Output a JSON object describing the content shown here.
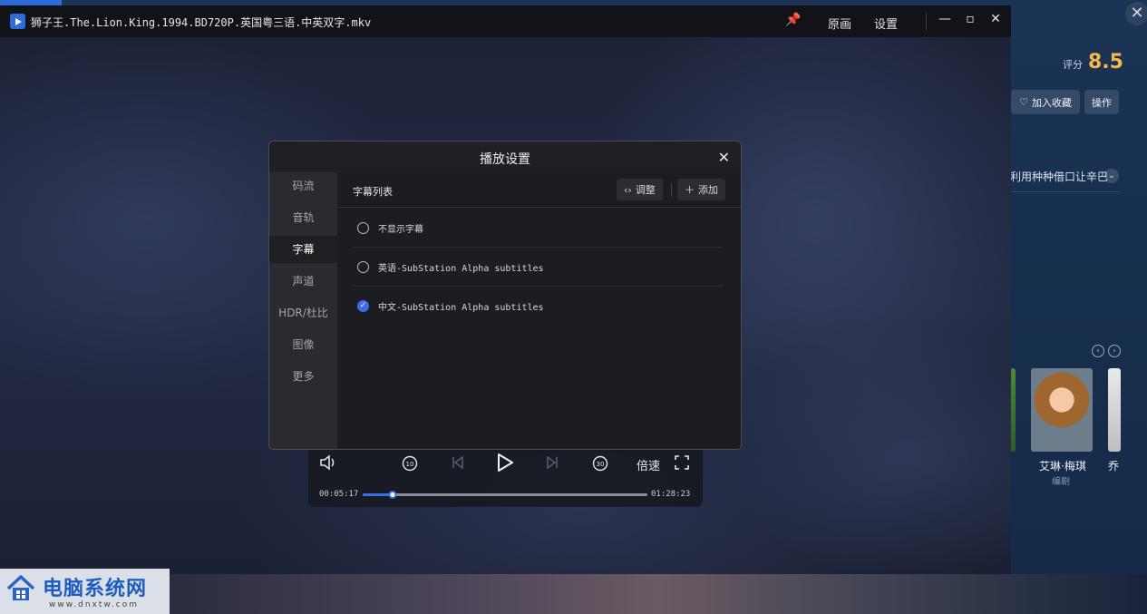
{
  "window": {
    "title": "狮子王.The.Lion.King.1994.BD720P.英国粤三语.中英双字.mkv",
    "menu": {
      "original_label": "原画",
      "settings_label": "设置"
    }
  },
  "controls": {
    "speed_label": "倍速",
    "current_time": "00:05:17",
    "total_time": "01:28:23",
    "progress": 0.106,
    "rewind_label": "10",
    "forward_label": "30"
  },
  "dialog": {
    "title": "播放设置",
    "tabs": [
      "码流",
      "音轨",
      "字幕",
      "声道",
      "HDR/杜比",
      "图像",
      "更多"
    ],
    "active_tab": "字幕",
    "list_title": "字幕列表",
    "adjust_label": "调整",
    "add_label": "添加",
    "subtitles": [
      {
        "label": "不显示字幕",
        "selected": false
      },
      {
        "label": "英语-SubStation Alpha subtitles",
        "selected": false
      },
      {
        "label": "中文-SubStation Alpha subtitles",
        "selected": true
      }
    ]
  },
  "background_app": {
    "rating_label": "评分",
    "rating_value": "8.5",
    "favorite_label": "加入收藏",
    "operate_label": "操作",
    "description_snippet": "利用种种借口让辛巴",
    "cast": [
      {
        "name": "艾琳·梅琪",
        "role": "编剧"
      },
      {
        "name": "乔",
        "role": ""
      }
    ]
  },
  "watermark": {
    "title": "电脑系统网",
    "url": "www.dnxtw.com"
  },
  "colors": {
    "accent": "#3b6ee6",
    "rating": "#f4b84a",
    "dialog_bg": "#1f2024",
    "sidebar_bg": "#2a2b30"
  }
}
